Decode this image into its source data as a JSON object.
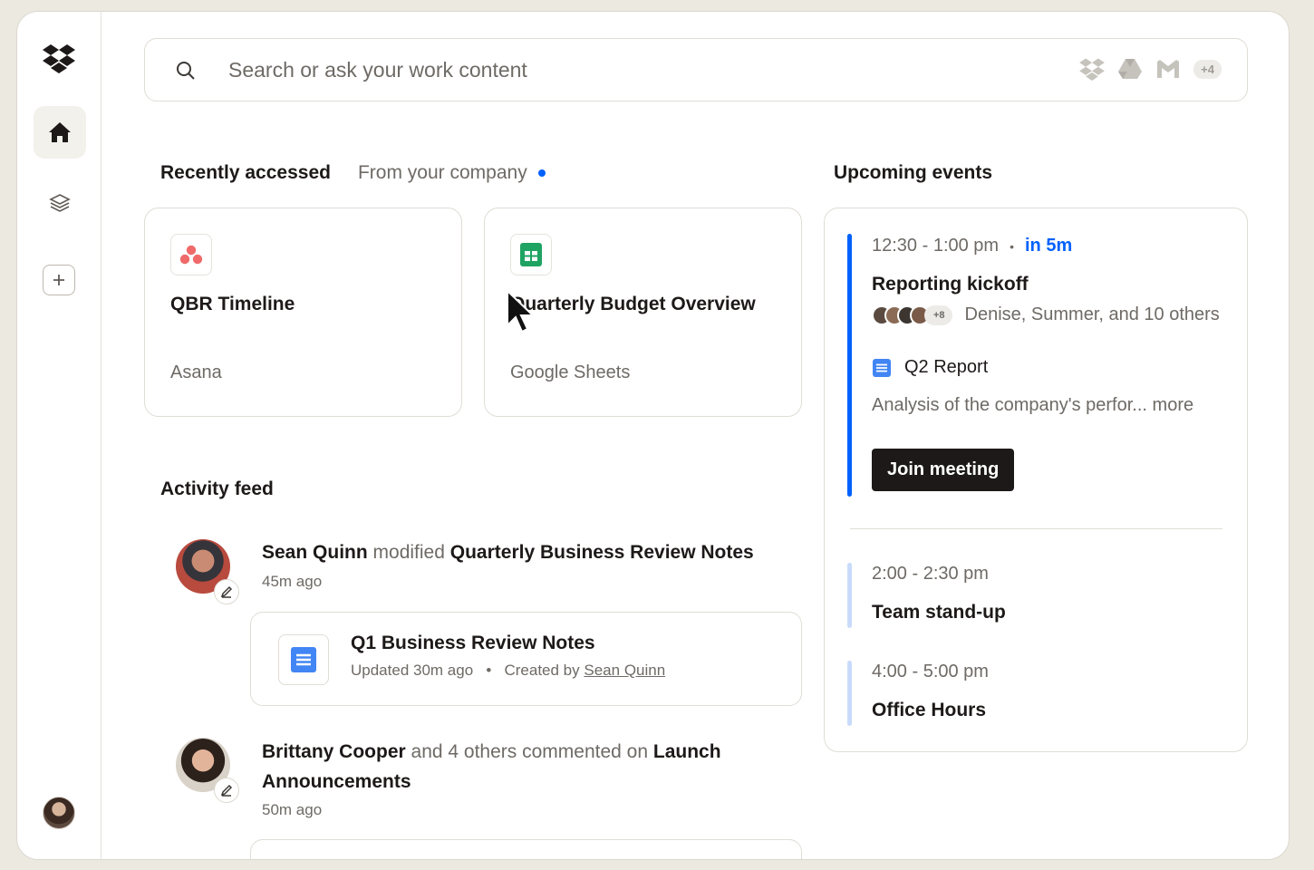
{
  "sidebar": {
    "items": [
      {
        "name": "home",
        "icon": "home-icon",
        "active": true
      },
      {
        "name": "stacks",
        "icon": "layers-icon",
        "active": false
      }
    ]
  },
  "search": {
    "placeholder": "Search or ask your work content",
    "integrations": [
      "dropbox-icon",
      "google-drive-icon",
      "gmail-icon"
    ],
    "more_count": "+4"
  },
  "tabs": {
    "recently_accessed": "Recently accessed",
    "from_company": "From your company"
  },
  "recent": [
    {
      "title": "QBR Timeline",
      "source": "Asana",
      "icon": "asana-icon"
    },
    {
      "title": "Quarterly Budget Overview",
      "source": "Google Sheets",
      "icon": "google-sheets-icon"
    }
  ],
  "feed": {
    "title": "Activity feed",
    "items": [
      {
        "actor": "Sean Quinn",
        "verb": "modified",
        "object": "Quarterly Business Review Notes",
        "time": "45m ago"
      },
      {
        "actor": "Brittany Cooper",
        "verb": "and 4 others commented on",
        "object": "Launch Announcements",
        "time": "50m ago"
      }
    ],
    "file": {
      "title": "Q1 Business Review Notes",
      "updated": "Updated 30m ago",
      "created_prefix": "Created by",
      "creator": "Sean Quinn"
    }
  },
  "events": {
    "title": "Upcoming events",
    "items": [
      {
        "time": "12:30 - 1:00 pm",
        "soon": "in 5m",
        "title": "Reporting kickoff",
        "attendee_extra": "+8",
        "attendees": "Denise, Summer, and 10 others",
        "doc": "Q2 Report",
        "desc": "Analysis of the company's perfor...",
        "more": "more",
        "join": "Join meeting"
      },
      {
        "time": "2:00 - 2:30 pm",
        "title": "Team stand-up"
      },
      {
        "time": "4:00 - 5:00 pm",
        "title": "Office Hours"
      }
    ]
  },
  "colors": {
    "accent": "#0061fe",
    "event_bar_active": "#0061fe",
    "event_bar_inactive": "#c9dbfb"
  }
}
